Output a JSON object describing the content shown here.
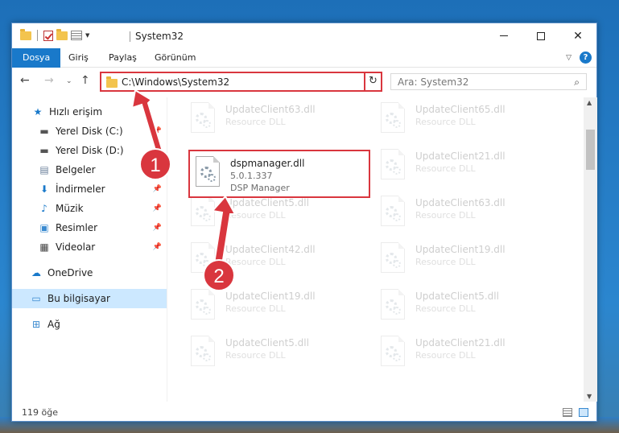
{
  "window": {
    "title": "System32"
  },
  "ribbon": {
    "tabs": [
      "Dosya",
      "Giriş",
      "Paylaş",
      "Görünüm"
    ],
    "help": "?"
  },
  "address": {
    "path": "C:\\Windows\\System32",
    "search_placeholder": "Ara: System32"
  },
  "sidebar": {
    "items": [
      {
        "label": "Hızlı erişim",
        "icon": "star-icon"
      },
      {
        "label": "Yerel Disk (C:)",
        "icon": "drive-icon"
      },
      {
        "label": "Yerel Disk (D:)",
        "icon": "drive-icon"
      },
      {
        "label": "Belgeler",
        "icon": "documents-icon"
      },
      {
        "label": "İndirmeler",
        "icon": "download-icon"
      },
      {
        "label": "Müzik",
        "icon": "music-icon"
      },
      {
        "label": "Resimler",
        "icon": "pictures-icon"
      },
      {
        "label": "Videolar",
        "icon": "videos-icon"
      },
      {
        "label": "OneDrive",
        "icon": "cloud-icon"
      },
      {
        "label": "Bu bilgisayar",
        "icon": "computer-icon"
      },
      {
        "label": "Ağ",
        "icon": "network-icon"
      }
    ]
  },
  "files": {
    "highlighted": {
      "name": "dspmanager.dll",
      "version": "5.0.1.337",
      "description": "DSP Manager"
    },
    "background": [
      {
        "name": "UpdateClient63.dll",
        "description": "Resource DLL"
      },
      {
        "name": "UpdateClient65.dll",
        "description": "Resource DLL"
      },
      {
        "name": "UpdateClient21.dll",
        "description": "Resource DLL"
      },
      {
        "name": "UpdateClient5.dll",
        "description": "Resource DLL"
      },
      {
        "name": "UpdateClient63.dll",
        "description": "Resource DLL"
      },
      {
        "name": "UpdateClient42.dll",
        "description": "Resource DLL"
      },
      {
        "name": "UpdateClient19.dll",
        "description": "Resource DLL"
      },
      {
        "name": "UpdateClient19.dll",
        "description": "Resource DLL"
      },
      {
        "name": "UpdateClient5.dll",
        "description": "Resource DLL"
      },
      {
        "name": "UpdateClient5.dll",
        "description": "Resource DLL"
      },
      {
        "name": "UpdateClient21.dll",
        "description": "Resource DLL"
      }
    ]
  },
  "status": {
    "count": "119 öğe"
  },
  "callouts": [
    "1",
    "2"
  ],
  "colors": {
    "accent": "#1979ca",
    "highlight": "#d9363e"
  }
}
